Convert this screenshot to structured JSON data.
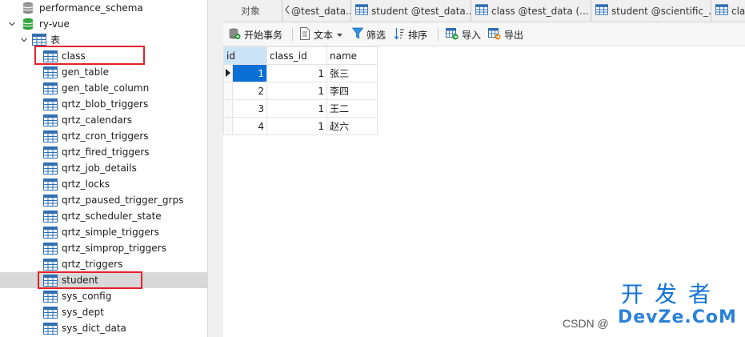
{
  "tree": {
    "items": [
      {
        "label": "performance_schema",
        "kind": "database",
        "expanded": false
      },
      {
        "label": "ry-vue",
        "kind": "database",
        "expanded": true
      },
      {
        "label": "表",
        "kind": "tables-folder",
        "expanded": true
      },
      {
        "label": "class",
        "kind": "table",
        "highlighted": true
      },
      {
        "label": "gen_table",
        "kind": "table"
      },
      {
        "label": "gen_table_column",
        "kind": "table"
      },
      {
        "label": "qrtz_blob_triggers",
        "kind": "table"
      },
      {
        "label": "qrtz_calendars",
        "kind": "table"
      },
      {
        "label": "qrtz_cron_triggers",
        "kind": "table"
      },
      {
        "label": "qrtz_fired_triggers",
        "kind": "table"
      },
      {
        "label": "qrtz_job_details",
        "kind": "table"
      },
      {
        "label": "qrtz_locks",
        "kind": "table"
      },
      {
        "label": "qrtz_paused_trigger_grps",
        "kind": "table"
      },
      {
        "label": "qrtz_scheduler_state",
        "kind": "table"
      },
      {
        "label": "qrtz_simple_triggers",
        "kind": "table"
      },
      {
        "label": "qrtz_simprop_triggers",
        "kind": "table"
      },
      {
        "label": "qrtz_triggers",
        "kind": "table"
      },
      {
        "label": "student",
        "kind": "table",
        "selected": true,
        "highlighted": true
      },
      {
        "label": "sys_config",
        "kind": "table"
      },
      {
        "label": "sys_dept",
        "kind": "table"
      },
      {
        "label": "sys_dict_data",
        "kind": "table"
      }
    ]
  },
  "tabs": [
    {
      "label": "对象",
      "has_icon": false
    },
    {
      "label": "@test_data...",
      "has_icon": false
    },
    {
      "label": "student @test_data...",
      "has_icon": true
    },
    {
      "label": "class @test_data (...",
      "has_icon": true
    },
    {
      "label": "student @scientific_...",
      "has_icon": true
    },
    {
      "label": "clas",
      "has_icon": true
    }
  ],
  "toolbar": {
    "begin_transaction": "开始事务",
    "text": "文本",
    "filter": "筛选",
    "sort": "排序",
    "import": "导入",
    "export": "导出"
  },
  "grid": {
    "columns": [
      "id",
      "class_id",
      "name"
    ],
    "rows": [
      {
        "id": "1",
        "class_id": "1",
        "name": "张三"
      },
      {
        "id": "2",
        "class_id": "1",
        "name": "李四"
      },
      {
        "id": "3",
        "class_id": "1",
        "name": "王二"
      },
      {
        "id": "4",
        "class_id": "1",
        "name": "赵六"
      }
    ]
  },
  "watermark": {
    "big_line1": "开发者",
    "big_line2": "DevZe.CoM",
    "csdn": "CSDN @"
  },
  "colors": {
    "highlight_box": "#e8202a",
    "db_icon_active": "#2a9d3a",
    "db_icon_inactive": "#8a8a8a",
    "table_icon": "#2f6fb0",
    "selected_cell": "#0a70d6",
    "selected_row": "#d9d9d9",
    "watermark": "#1474d4"
  }
}
